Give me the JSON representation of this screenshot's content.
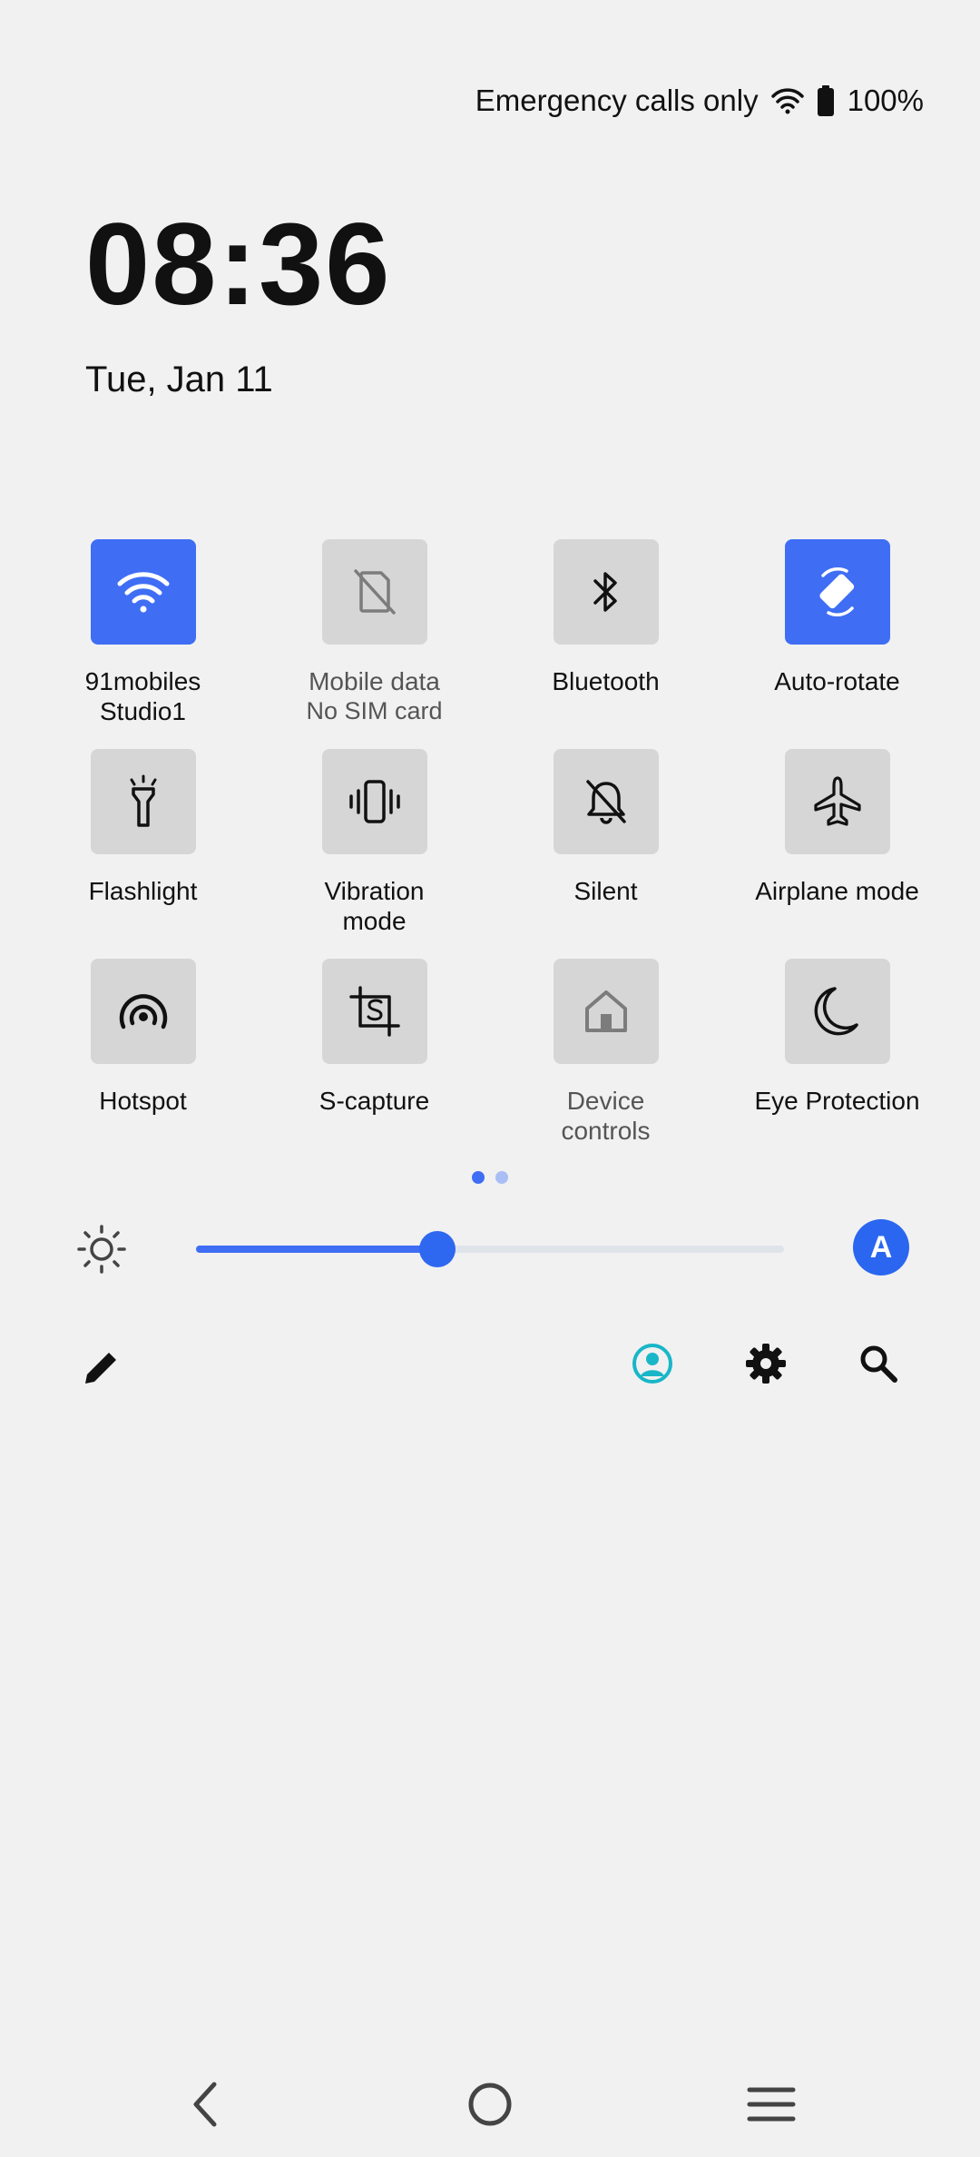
{
  "status": {
    "carrier_text": "Emergency calls only",
    "battery": "100%",
    "icons": [
      "wifi-icon",
      "battery-icon"
    ]
  },
  "clock": {
    "time": "08:36",
    "date": "Tue, Jan 11"
  },
  "tiles": [
    {
      "label": "91mobiles\nStudio1",
      "state": "on",
      "icon": "wifi-icon"
    },
    {
      "label": "Mobile data",
      "sublabel": "No SIM card",
      "state": "unavailable",
      "icon": "no-sim-icon"
    },
    {
      "label": "Bluetooth",
      "state": "off",
      "icon": "bluetooth-icon"
    },
    {
      "label": "Auto-rotate",
      "state": "on",
      "icon": "auto-rotate-icon"
    },
    {
      "label": "Flashlight",
      "state": "off",
      "icon": "flashlight-icon"
    },
    {
      "label": "Vibration\nmode",
      "state": "off",
      "icon": "vibration-icon"
    },
    {
      "label": "Silent",
      "state": "off",
      "icon": "silent-icon"
    },
    {
      "label": "Airplane mode",
      "state": "off",
      "icon": "airplane-icon"
    },
    {
      "label": "Hotspot",
      "state": "off",
      "icon": "hotspot-icon"
    },
    {
      "label": "S-capture",
      "state": "off",
      "icon": "screenshot-icon"
    },
    {
      "label": "Device\ncontrols",
      "state": "unavailable",
      "icon": "home-icon"
    },
    {
      "label": "Eye Protection",
      "state": "off",
      "icon": "moon-icon"
    }
  ],
  "pager": {
    "pages": 2,
    "current": 1
  },
  "brightness": {
    "level": 0.41,
    "auto_label": "A"
  },
  "actions": [
    "edit-icon",
    "user-icon",
    "settings-icon",
    "search-icon"
  ],
  "nav": [
    "back-icon",
    "home-icon",
    "recents-icon"
  ],
  "colors": {
    "accent": "#3f6ef5",
    "tile_off": "#d6d6d6",
    "background": "#f1f1f1",
    "user_accent": "#19b6c8"
  }
}
